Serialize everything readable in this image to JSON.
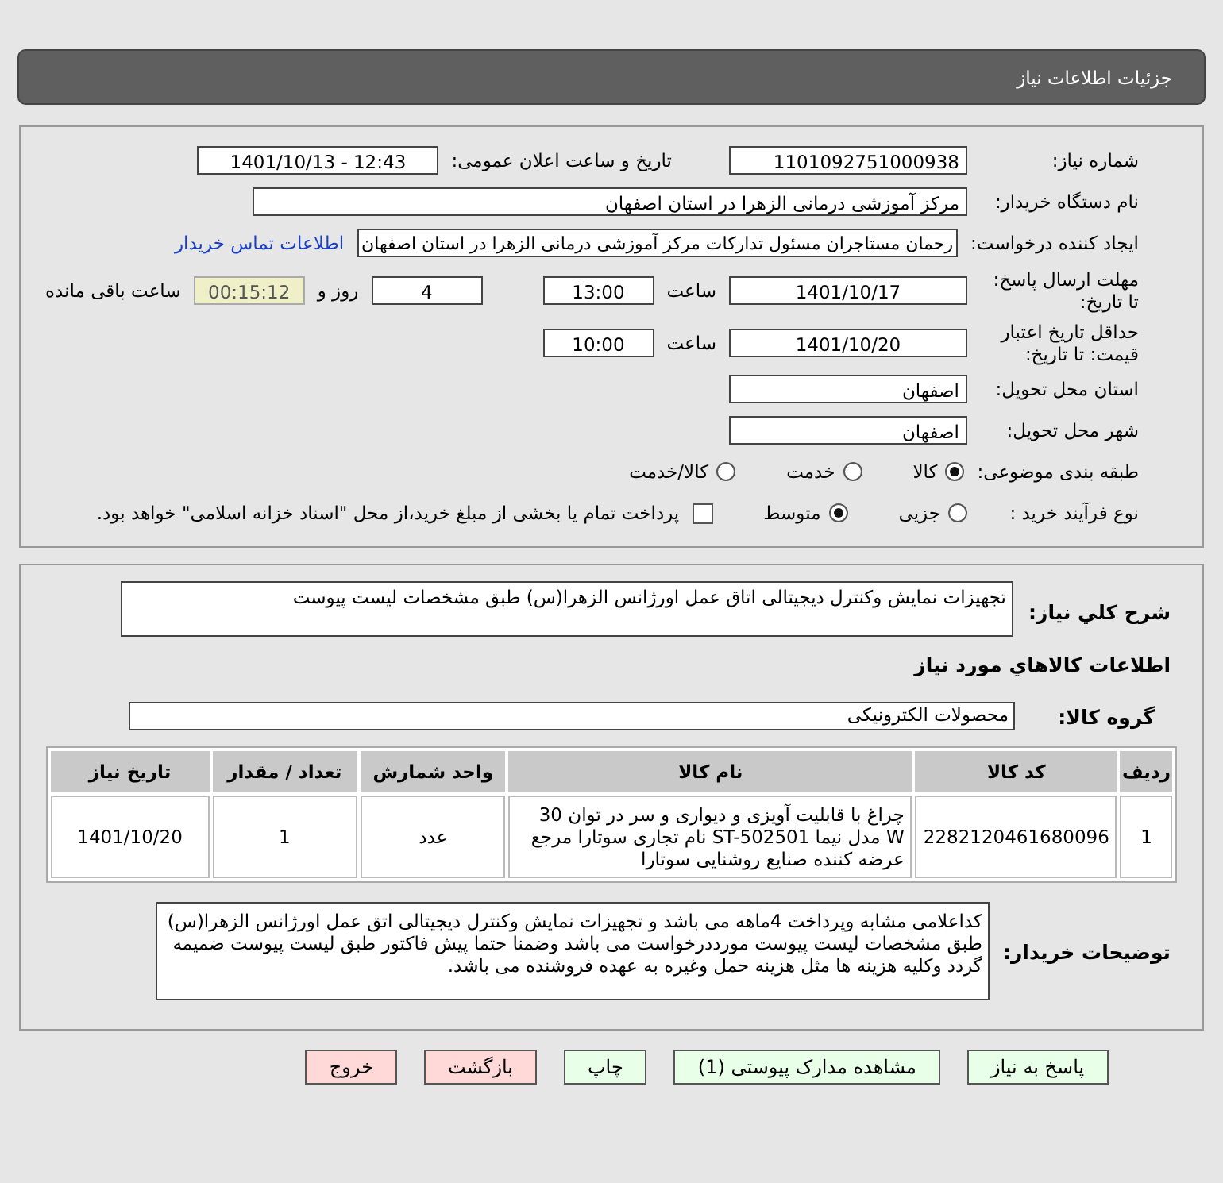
{
  "header": {
    "title": "جزئیات اطلاعات نیاز"
  },
  "details": {
    "need_number": {
      "label": "شماره نیاز:",
      "value": "1101092751000938"
    },
    "announce": {
      "label": "تاریخ و ساعت اعلان عمومی:",
      "value": "1401/10/13 - 12:43"
    },
    "buyer_org": {
      "label": "نام دستگاه خریدار:",
      "value": "مرکز آموزشی درمانی الزهرا در استان اصفهان"
    },
    "requester": {
      "label": "ایجاد کننده درخواست:",
      "value": "رحمان مستاجران مسئول تداركات مرکز آموزشی درمانی الزهرا در استان اصفهان",
      "link": "اطلاعات تماس خریدار"
    },
    "deadline": {
      "label": "مهلت ارسال پاسخ: تا تاریخ:",
      "date": "1401/10/17",
      "time_label": "ساعت",
      "time": "13:00",
      "days": "4",
      "days_label": "روز و",
      "remaining": "00:15:12",
      "remaining_label": "ساعت باقی مانده"
    },
    "validity": {
      "label": "حداقل تاریخ اعتبار قیمت: تا تاریخ:",
      "date": "1401/10/20",
      "time_label": "ساعت",
      "time": "10:00"
    },
    "province": {
      "label": "استان محل تحویل:",
      "value": "اصفهان"
    },
    "city": {
      "label": "شهر محل تحویل:",
      "value": "اصفهان"
    },
    "category": {
      "label": "طبقه بندی موضوعی:",
      "options": [
        {
          "label": "کالا",
          "selected": true
        },
        {
          "label": "خدمت",
          "selected": false
        },
        {
          "label": "کالا/خدمت",
          "selected": false
        }
      ]
    },
    "process": {
      "label": "نوع فرآیند خرید :",
      "options": [
        {
          "label": "جزیی",
          "selected": false
        },
        {
          "label": "متوسط",
          "selected": true
        }
      ],
      "payment": {
        "label": "پرداخت تمام یا بخشی از مبلغ خرید،از محل \"اسناد خزانه اسلامی\" خواهد بود.",
        "checked": false
      }
    }
  },
  "goods": {
    "summary": {
      "label": "شرح کلي نياز:",
      "value": "تجهیزات نمایش وکنترل دیجیتالی اتاق عمل اورژانس الزهرا(س) طبق مشخصات لیست پیوست"
    },
    "title": "اطلاعات کالاهاي مورد نياز",
    "group": {
      "label": "گروه کالا:",
      "value": "محصولات الکترونیکی"
    },
    "table": {
      "columns": [
        "ردیف",
        "کد کالا",
        "نام کالا",
        "واحد شمارش",
        "تعداد / مقدار",
        "تاریخ نیاز"
      ],
      "rows": [
        [
          "1",
          "2282120461680096",
          "چراغ با قابلیت آویزی و دیواری و سر در توان 30 W مدل نیما ST-502501 نام تجاری سوتارا مرجع عرضه کننده صنایع روشنایی سوتارا",
          "عدد",
          "1",
          "1401/10/20"
        ]
      ]
    },
    "notes": {
      "label": "توضیحات خریدار:",
      "value": "کداعلامی مشابه وپرداخت 4ماهه می باشد و تجهیزات نمایش وکنترل دیجیتالی اتق عمل اورژانس الزهرا(س) طبق مشخصات لیست پیوست مورددرخواست می باشد وضمنا حتما پیش فاکتور طبق لیست پیوست ضمیمه گردد وکلیه هزینه ها مثل هزینه حمل وغیره به عهده فروشنده می باشد."
    }
  },
  "buttons": [
    {
      "label": "پاسخ به نیاز",
      "kind": "action"
    },
    {
      "label": "مشاهده مدارک پیوستی (1)",
      "kind": "action"
    },
    {
      "label": "چاپ",
      "kind": "action"
    },
    {
      "label": "بازگشت",
      "kind": "nav"
    },
    {
      "label": "خروج",
      "kind": "nav"
    }
  ]
}
